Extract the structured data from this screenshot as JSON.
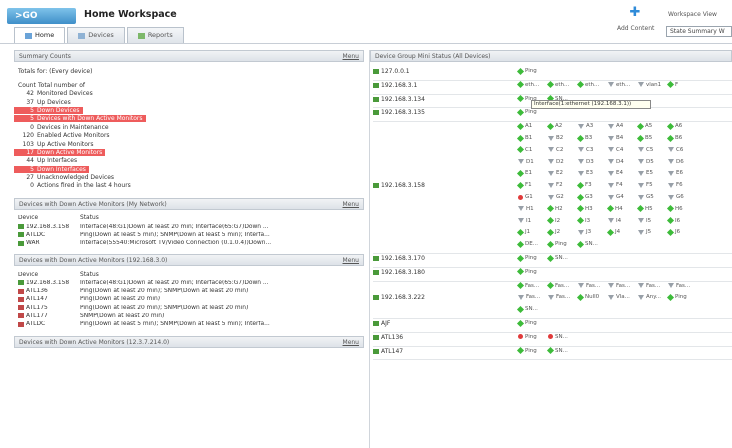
{
  "header": {
    "go_label": ">GO",
    "title": "Home Workspace",
    "tabs": [
      {
        "label": "Home"
      },
      {
        "label": "Devices"
      },
      {
        "label": "Reports"
      }
    ],
    "add_label": "Add Content",
    "workspace_view_label": "Workspace View",
    "workspace_view_value": "State Summary W"
  },
  "summary": {
    "title": "Summary Counts",
    "menu": "Menu",
    "totals": "Totals for: (Every device)",
    "col_count": "Count",
    "col_total": "Total number of",
    "rows": [
      {
        "count": "42",
        "label": "Monitored Devices",
        "red": false
      },
      {
        "count": "37",
        "label": "Up Devices",
        "red": false
      },
      {
        "count": "5",
        "label": "Down Devices",
        "red": true
      },
      {
        "count": "5",
        "label": "Devices with Down Active Monitors",
        "red": true
      },
      {
        "count": "0",
        "label": "Devices in Maintenance",
        "red": false
      },
      {
        "count": "120",
        "label": "Enabled Active Monitors",
        "red": false
      },
      {
        "count": "103",
        "label": "Up Active Monitors",
        "red": false
      },
      {
        "count": "17",
        "label": "Down Active Monitors",
        "red": true
      },
      {
        "count": "44",
        "label": "Up Interfaces",
        "red": false
      },
      {
        "count": "5",
        "label": "Down Interfaces",
        "red": true
      },
      {
        "count": "27",
        "label": "Unacknowledged Devices",
        "red": false
      },
      {
        "count": "0",
        "label": "Actions fired in the last 4 hours",
        "red": false
      }
    ]
  },
  "panel2": {
    "title": "Devices with Down Active Monitors (My Network)",
    "menu": "Menu",
    "col_device": "Device",
    "col_status": "Status",
    "rows": [
      {
        "device": "192.168.3.158",
        "status": "Interface(48:G1)Down at least 20 min; Interface(65:G7)Down ...",
        "up": true
      },
      {
        "device": "ATLDC",
        "status": "Ping(Down at least 5 min); SNMP(Down at least 5 min); Interfa...",
        "up": true
      },
      {
        "device": "WAR",
        "status": "Interface(55540:Microsoft TV/Video Connection (0.1.0.4))Down...",
        "up": true
      }
    ]
  },
  "panel3": {
    "title": "Devices with Down Active Monitors (192.168.3.0)",
    "menu": "Menu",
    "col_device": "Device",
    "col_status": "Status",
    "rows": [
      {
        "device": "192.168.3.158",
        "status": "Interface(48:G1)Down at least 20 min; Interface(65:G7)Down ...",
        "up": true
      },
      {
        "device": "ATL136",
        "status": "Ping(Down at least 20 min); SNMP(Down at least 20 min)",
        "up": false
      },
      {
        "device": "ATL147",
        "status": "Ping(Down at least 20 min)",
        "up": false
      },
      {
        "device": "ATL175",
        "status": "Ping(Down at least 20 min); SNMP(Down at least 20 min)",
        "up": false
      },
      {
        "device": "ATL177",
        "status": "SNMP(Down at least 20 min)",
        "up": false
      },
      {
        "device": "ATLDC",
        "status": "Ping(Down at least 5 min); SNMP(Down at least 5 min); Interfa...",
        "up": false
      }
    ]
  },
  "panel4": {
    "title": "Devices with Down Active Monitors (12.3.7.214.0)",
    "menu": "Menu"
  },
  "status_panel": {
    "title": "Device Group Mini Status (All Devices)",
    "tooltip": "Interface(1:ethernet (192.168.3.1))",
    "devices": [
      {
        "name": "127.0.0.1",
        "monitors": [
          [
            "Ping",
            "up"
          ]
        ]
      },
      {
        "name": "192.168.3.1",
        "monitors": [
          [
            "eth...",
            "up"
          ],
          [
            "eth...",
            "up"
          ],
          [
            "eth...",
            "up"
          ],
          [
            "eth...",
            "down"
          ],
          [
            "vlan1",
            "down"
          ],
          [
            "F",
            "up"
          ]
        ]
      },
      {
        "name": "192.168.3.134",
        "monitors": [
          [
            "Ping",
            "up"
          ],
          [
            "SN...",
            "up"
          ]
        ]
      },
      {
        "name": "192.168.3.135",
        "monitors": [
          [
            "Ping",
            "up"
          ]
        ]
      },
      {
        "name": "192.168.3.158",
        "monitors": [
          [
            "A1",
            "up"
          ],
          [
            "A2",
            "up"
          ],
          [
            "A3",
            "down"
          ],
          [
            "A4",
            "down"
          ],
          [
            "A5",
            "up"
          ],
          [
            "A6",
            "up"
          ],
          [
            "B1",
            "up"
          ],
          [
            "B2",
            "down"
          ],
          [
            "B3",
            "up"
          ],
          [
            "B4",
            "down"
          ],
          [
            "B5",
            "up"
          ],
          [
            "B6",
            "up"
          ],
          [
            "C1",
            "up"
          ],
          [
            "C2",
            "down"
          ],
          [
            "C3",
            "down"
          ],
          [
            "C4",
            "down"
          ],
          [
            "C5",
            "down"
          ],
          [
            "C6",
            "down"
          ],
          [
            "D1",
            "down"
          ],
          [
            "D2",
            "down"
          ],
          [
            "D3",
            "down"
          ],
          [
            "D4",
            "down"
          ],
          [
            "D5",
            "down"
          ],
          [
            "D6",
            "down"
          ],
          [
            "E1",
            "up"
          ],
          [
            "E2",
            "down"
          ],
          [
            "E3",
            "down"
          ],
          [
            "E4",
            "down"
          ],
          [
            "E5",
            "down"
          ],
          [
            "E6",
            "down"
          ],
          [
            "F1",
            "up"
          ],
          [
            "F2",
            "down"
          ],
          [
            "F3",
            "up"
          ],
          [
            "F4",
            "down"
          ],
          [
            "F5",
            "down"
          ],
          [
            "F6",
            "down"
          ],
          [
            "G1",
            "red"
          ],
          [
            "G2",
            "down"
          ],
          [
            "G3",
            "up"
          ],
          [
            "G4",
            "down"
          ],
          [
            "G5",
            "down"
          ],
          [
            "G6",
            "down"
          ],
          [
            "H1",
            "down"
          ],
          [
            "H2",
            "up"
          ],
          [
            "H3",
            "up"
          ],
          [
            "H4",
            "up"
          ],
          [
            "H5",
            "up"
          ],
          [
            "H6",
            "up"
          ],
          [
            "I1",
            "down"
          ],
          [
            "I2",
            "up"
          ],
          [
            "I3",
            "up"
          ],
          [
            "I4",
            "down"
          ],
          [
            "I5",
            "down"
          ],
          [
            "I6",
            "up"
          ],
          [
            "J1",
            "up"
          ],
          [
            "J2",
            "up"
          ],
          [
            "J3",
            "down"
          ],
          [
            "J4",
            "up"
          ],
          [
            "J5",
            "down"
          ],
          [
            "J6",
            "up"
          ],
          [
            "DE...",
            "up"
          ],
          [
            "Ping",
            "up"
          ],
          [
            "SN...",
            "up"
          ]
        ]
      },
      {
        "name": "192.168.3.170",
        "monitors": [
          [
            "Ping",
            "up"
          ],
          [
            "SN...",
            "up"
          ]
        ]
      },
      {
        "name": "192.168.3.180",
        "monitors": [
          [
            "Ping",
            "up"
          ]
        ]
      },
      {
        "name": "192.168.3.222",
        "monitors": [
          [
            "Fas...",
            "up"
          ],
          [
            "Fas...",
            "up"
          ],
          [
            "Fas...",
            "down"
          ],
          [
            "Fas...",
            "down"
          ],
          [
            "Fas...",
            "down"
          ],
          [
            "Fas...",
            "down"
          ],
          [
            "Fas...",
            "down"
          ],
          [
            "Fas...",
            "down"
          ],
          [
            "Null0",
            "up"
          ],
          [
            "Vla...",
            "down"
          ],
          [
            "Any...",
            "down"
          ],
          [
            "Ping",
            "up"
          ],
          [
            "SN...",
            "up"
          ]
        ]
      },
      {
        "name": "AJF",
        "monitors": [
          [
            "Ping",
            "up"
          ]
        ]
      },
      {
        "name": "ATL136",
        "monitors": [
          [
            "Ping",
            "red"
          ],
          [
            "SN...",
            "red"
          ]
        ]
      },
      {
        "name": "ATL147",
        "monitors": [
          [
            "Ping",
            "up"
          ],
          [
            "SN...",
            "up"
          ]
        ]
      }
    ]
  }
}
